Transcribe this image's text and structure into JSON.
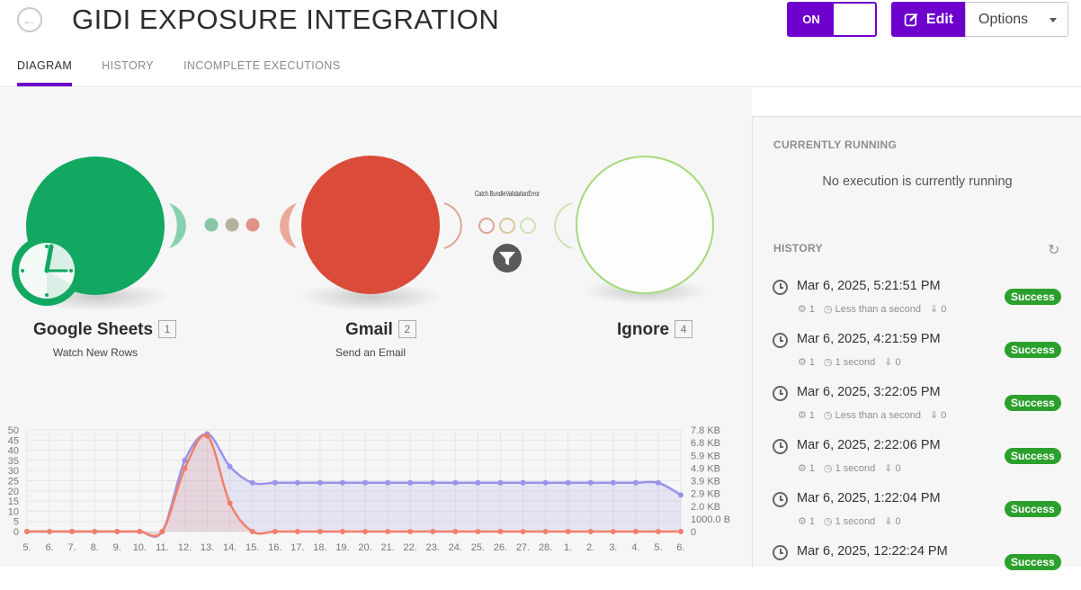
{
  "header": {
    "title": "GIDI EXPOSURE INTEGRATION",
    "toggle_label": "ON",
    "edit_label": "Edit",
    "options_label": "Options"
  },
  "tabs": [
    {
      "label": "DIAGRAM",
      "active": true
    },
    {
      "label": "HISTORY",
      "active": false
    },
    {
      "label": "INCOMPLETE EXECUTIONS",
      "active": false
    }
  ],
  "modules": [
    {
      "name": "Google Sheets",
      "number": "1",
      "action": "Watch New Rows",
      "color": "#12a862",
      "icon": "clock-icon"
    },
    {
      "name": "Gmail",
      "number": "2",
      "action": "Send an Email",
      "color": "#db4b3a",
      "icon": ""
    },
    {
      "name": "Ignore",
      "number": "4",
      "action": "",
      "color": "#a5d97a",
      "icon": ""
    }
  ],
  "route": {
    "filter_label": "Catch BundleValidationError",
    "filter_icon": "filter-icon"
  },
  "side": {
    "running_heading": "CURRENTLY RUNNING",
    "running_text": "No execution is currently running",
    "history_heading": "HISTORY",
    "history": [
      {
        "date": "Mar 6, 2025, 5:21:51 PM",
        "ops": "1",
        "duration": "Less than a second",
        "transfer": "0",
        "status": "Success"
      },
      {
        "date": "Mar 6, 2025, 4:21:59 PM",
        "ops": "1",
        "duration": "1 second",
        "transfer": "0",
        "status": "Success"
      },
      {
        "date": "Mar 6, 2025, 3:22:05 PM",
        "ops": "1",
        "duration": "Less than a second",
        "transfer": "0",
        "status": "Success"
      },
      {
        "date": "Mar 6, 2025, 2:22:06 PM",
        "ops": "1",
        "duration": "1 second",
        "transfer": "0",
        "status": "Success"
      },
      {
        "date": "Mar 6, 2025, 1:22:04 PM",
        "ops": "1",
        "duration": "1 second",
        "transfer": "0",
        "status": "Success"
      },
      {
        "date": "Mar 6, 2025, 12:22:24 PM",
        "ops": "",
        "duration": "",
        "transfer": "",
        "status": "Success"
      }
    ]
  },
  "chart_data": {
    "type": "area",
    "categories": [
      "5.",
      "6.",
      "7.",
      "8.",
      "9.",
      "10.",
      "11.",
      "12.",
      "13.",
      "14.",
      "15.",
      "16.",
      "17.",
      "18.",
      "19.",
      "20.",
      "21.",
      "22.",
      "23.",
      "24.",
      "25.",
      "26.",
      "27.",
      "28.",
      "1.",
      "2.",
      "3.",
      "4.",
      "5.",
      "6."
    ],
    "y_left_ticks": [
      "0",
      "5",
      "10",
      "15",
      "20",
      "25",
      "30",
      "35",
      "40",
      "45",
      "50"
    ],
    "y_right_ticks": [
      "0",
      "1000.0 B",
      "2.0 KB",
      "2.9 KB",
      "3.9 KB",
      "4.9 KB",
      "5.9 KB",
      "6.8 KB",
      "7.8 KB"
    ],
    "ylim_left": [
      0,
      50
    ],
    "series": [
      {
        "values": [
          0,
          0,
          0,
          0,
          0,
          0,
          0,
          31,
          47,
          14,
          0,
          0,
          0,
          0,
          0,
          0,
          0,
          0,
          0,
          0,
          0,
          0,
          0,
          0,
          0,
          0,
          0,
          0,
          0,
          0
        ],
        "color": "#f0806a",
        "axis": "left"
      },
      {
        "values": [
          0,
          0,
          0,
          0,
          0,
          0,
          0,
          35,
          48,
          32,
          24,
          24,
          24,
          24,
          24,
          24,
          24,
          24,
          24,
          24,
          24,
          24,
          24,
          24,
          24,
          24,
          24,
          24,
          24,
          18
        ],
        "color": "#9b93ea",
        "axis": "left"
      }
    ],
    "grid": true
  }
}
